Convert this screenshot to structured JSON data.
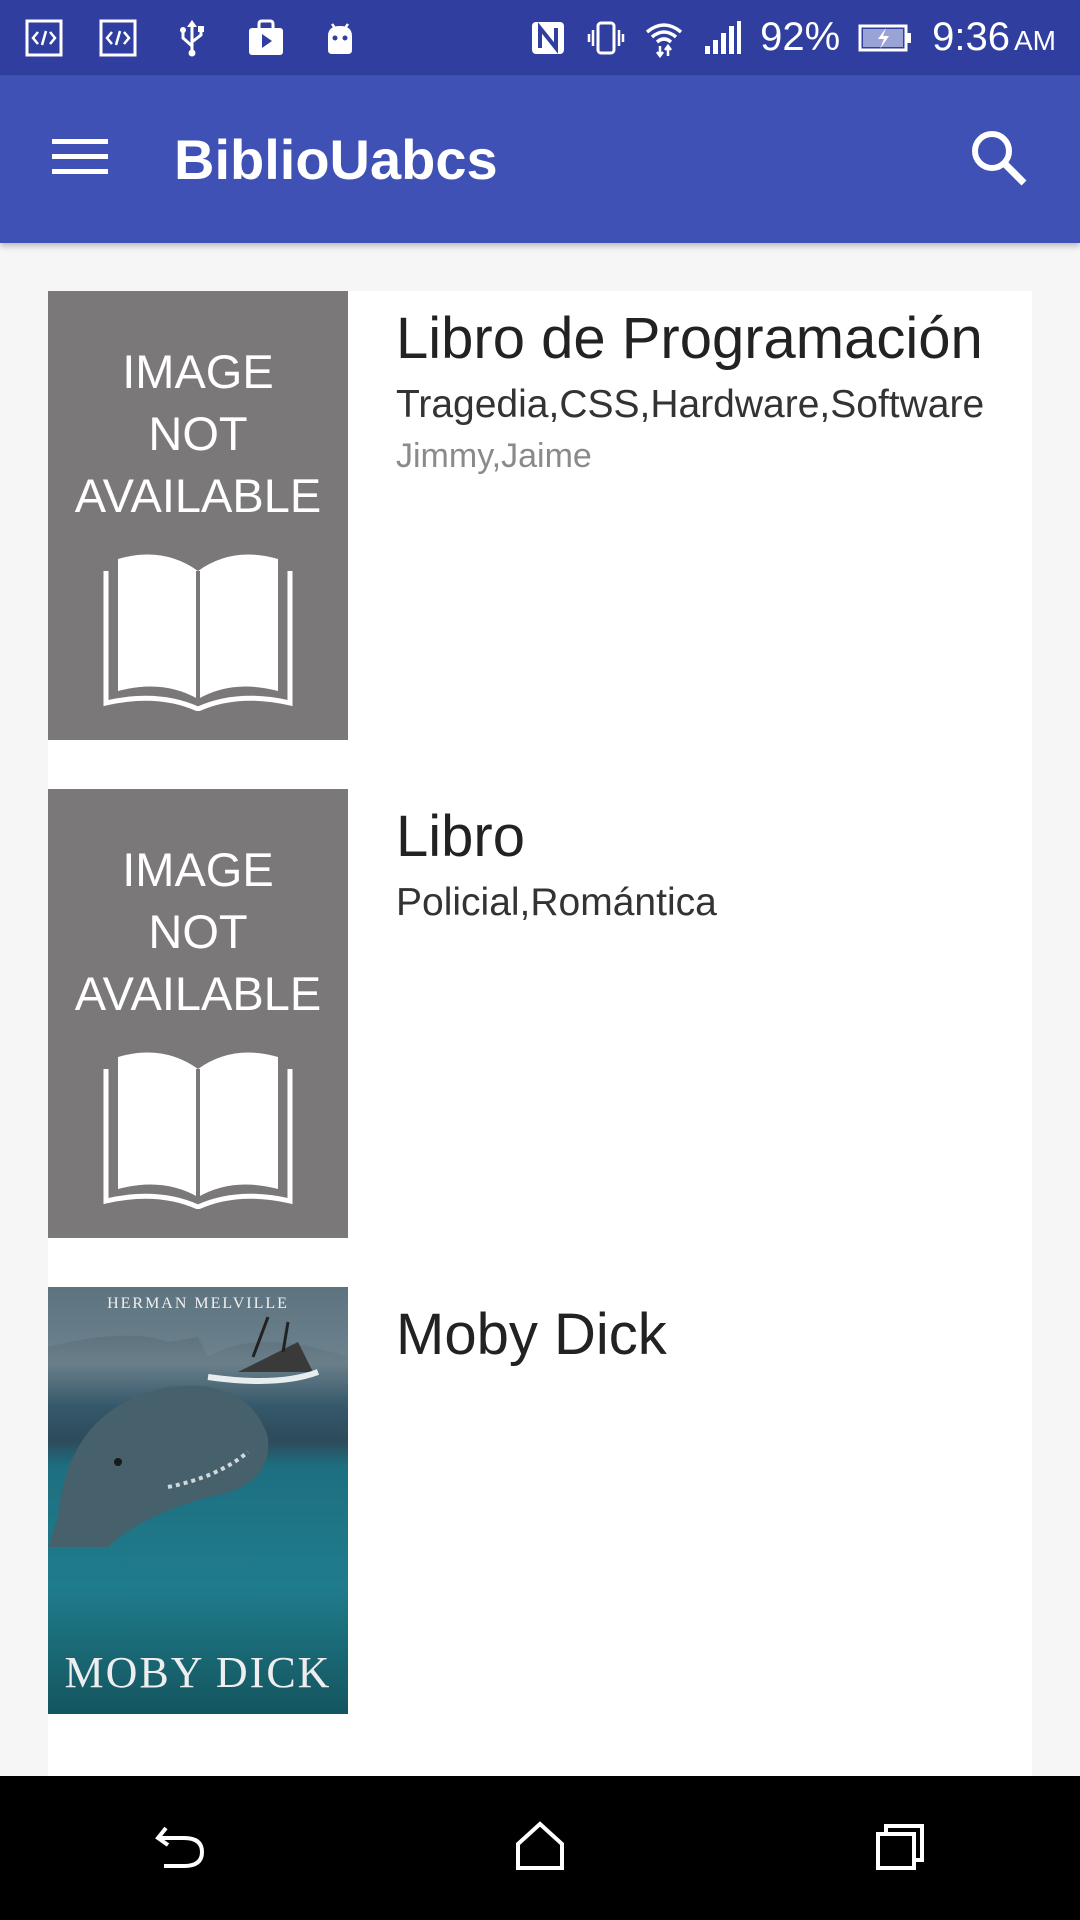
{
  "status_bar": {
    "battery_percent": "92%",
    "time": "9:36",
    "ampm": "AM",
    "icons": [
      "code-icon",
      "code-icon",
      "usb-icon",
      "play-store-icon",
      "android-icon",
      "nfc-icon",
      "vibrate-icon",
      "wifi-icon",
      "signal-icon",
      "battery-charging-icon"
    ]
  },
  "app_bar": {
    "title": "BiblioUabcs",
    "menu_icon": "menu-icon",
    "search_icon": "search-icon"
  },
  "colors": {
    "status_bar": "#303f9f",
    "app_bar": "#3f51b5",
    "placeholder_cover": "#7b7879"
  },
  "books": [
    {
      "title": "Libro de Programación",
      "genres": "Tragedia,CSS,Hardware,Software",
      "authors": "Jimmy,Jaime",
      "cover": {
        "line1": "IMAGE",
        "line2": "NOT",
        "line3": "AVAILABLE"
      }
    },
    {
      "title": "Libro",
      "genres": "Policial,Romántica",
      "authors": "",
      "cover": {
        "line1": "IMAGE",
        "line2": "NOT",
        "line3": "AVAILABLE"
      }
    },
    {
      "title": "Moby Dick",
      "genres": "",
      "authors": "",
      "cover": {
        "author": "HERMAN MELVILLE",
        "title": "MOBY DICK"
      }
    }
  ],
  "nav_bar": {
    "icons": [
      "back-icon",
      "home-icon",
      "recents-icon"
    ]
  }
}
